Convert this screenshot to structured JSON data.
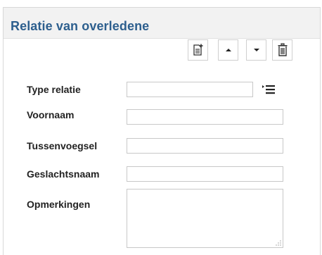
{
  "panel": {
    "title": "Relatie van overledene"
  },
  "toolbar": {
    "buttons": [
      {
        "name": "add-record-button",
        "icon": "add-record-icon"
      },
      {
        "name": "move-up-button",
        "icon": "triangle-up-icon"
      },
      {
        "name": "move-down-button",
        "icon": "triangle-down-icon"
      },
      {
        "name": "delete-button",
        "icon": "trash-icon"
      }
    ]
  },
  "form": {
    "type_relatie": {
      "label": "Type relatie",
      "value": ""
    },
    "voornaam": {
      "label": "Voornaam",
      "value": ""
    },
    "tussenvoegsel": {
      "label": "Tussenvoegsel",
      "value": ""
    },
    "geslachtsnaam": {
      "label": "Geslachtsnaam",
      "value": ""
    },
    "opmerkingen": {
      "label": "Opmerkingen",
      "value": ""
    }
  },
  "icons": {
    "list_picker": "list-picker-icon"
  },
  "colors": {
    "title": "#2d5f8e",
    "header_bg": "#f2f2f2",
    "border": "#c8c8c8"
  }
}
